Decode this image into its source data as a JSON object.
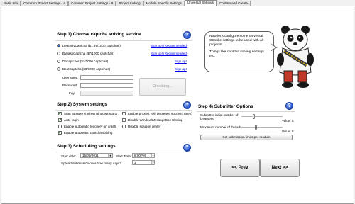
{
  "tabs": [
    {
      "label": "Basic Info",
      "active": false
    },
    {
      "label": "Common Project Settings - A",
      "active": false
    },
    {
      "label": "Common Project Settings - B",
      "active": false
    },
    {
      "label": "Project Linking",
      "active": false
    },
    {
      "label": "Module Specific Settings",
      "active": false
    },
    {
      "label": "Universal Settings",
      "active": true
    },
    {
      "label": "Confirm and Create",
      "active": false
    }
  ],
  "step1": {
    "title": "Step 1) Choose captcha solving service",
    "services": [
      {
        "label": "DeathByCaptcha ($1.39/1000 captchas)",
        "selected": true,
        "signup": "Sign up! (Recommended)"
      },
      {
        "label": "BypassCaptcha ($7/1000 captchas)",
        "selected": false,
        "signup": "Sign up! (Recommended)"
      },
      {
        "label": "Decaptcher ($2/1000 captchas)",
        "selected": false,
        "signup": "Sign up!"
      },
      {
        "label": "BeatCaptcha ($8/1000 captchas)",
        "selected": false,
        "signup": "Sign up!"
      }
    ],
    "username_label": "Username:",
    "username_value": "",
    "password_label": "Password:",
    "password_value": "",
    "key_label": "Key:",
    "key_value": "",
    "check_button": "Checking..."
  },
  "step2": {
    "title": "Step 2) System settings",
    "left_options": [
      {
        "label": "Start SEnuke X when windows starts",
        "checked": true
      },
      {
        "label": "Auto-login",
        "checked": true
      },
      {
        "label": "Enable automatic recovery on crash",
        "checked": false
      },
      {
        "label": "Enable automatic captcha solving",
        "checked": true
      }
    ],
    "right_options": [
      {
        "label": "Enable proxies (will decrease success rates)",
        "checked": false
      },
      {
        "label": "Disable Window\\MessageBox Closing",
        "checked": false
      },
      {
        "label": "Disable solution center",
        "checked": false
      }
    ]
  },
  "step3": {
    "title": "Step 3) Scheduling settings",
    "start_date_label": "Start date:",
    "start_date_value": "16/09/2011",
    "start_time_label": "Start Time:",
    "start_time_value": "8:00PM",
    "spread_label": "Spread submission over how many days?",
    "spread_value": "3"
  },
  "step4": {
    "title": "Step 4) Submitter Options",
    "threads_initial_label": "Submitter initial number of browsers",
    "threads_initial_value_text": "Value: 5",
    "threads_initial_fraction": 0.3,
    "threads_max_label": "Maximum number of threads",
    "threads_max_value_text": "Value: 8",
    "threads_max_fraction": 0.35,
    "limits_button": "Set submission limits per module"
  },
  "assistant": {
    "line1": "Now let's configure some universal SEnuke settings to be used with all projects...",
    "line2": "Things like captcha solving settings etc."
  },
  "nav": {
    "prev": "<< Prev",
    "next": "Next >>"
  },
  "help_glyph": "?",
  "colors": {
    "help_blue": "#2550c8",
    "link_blue": "#0000ee"
  }
}
